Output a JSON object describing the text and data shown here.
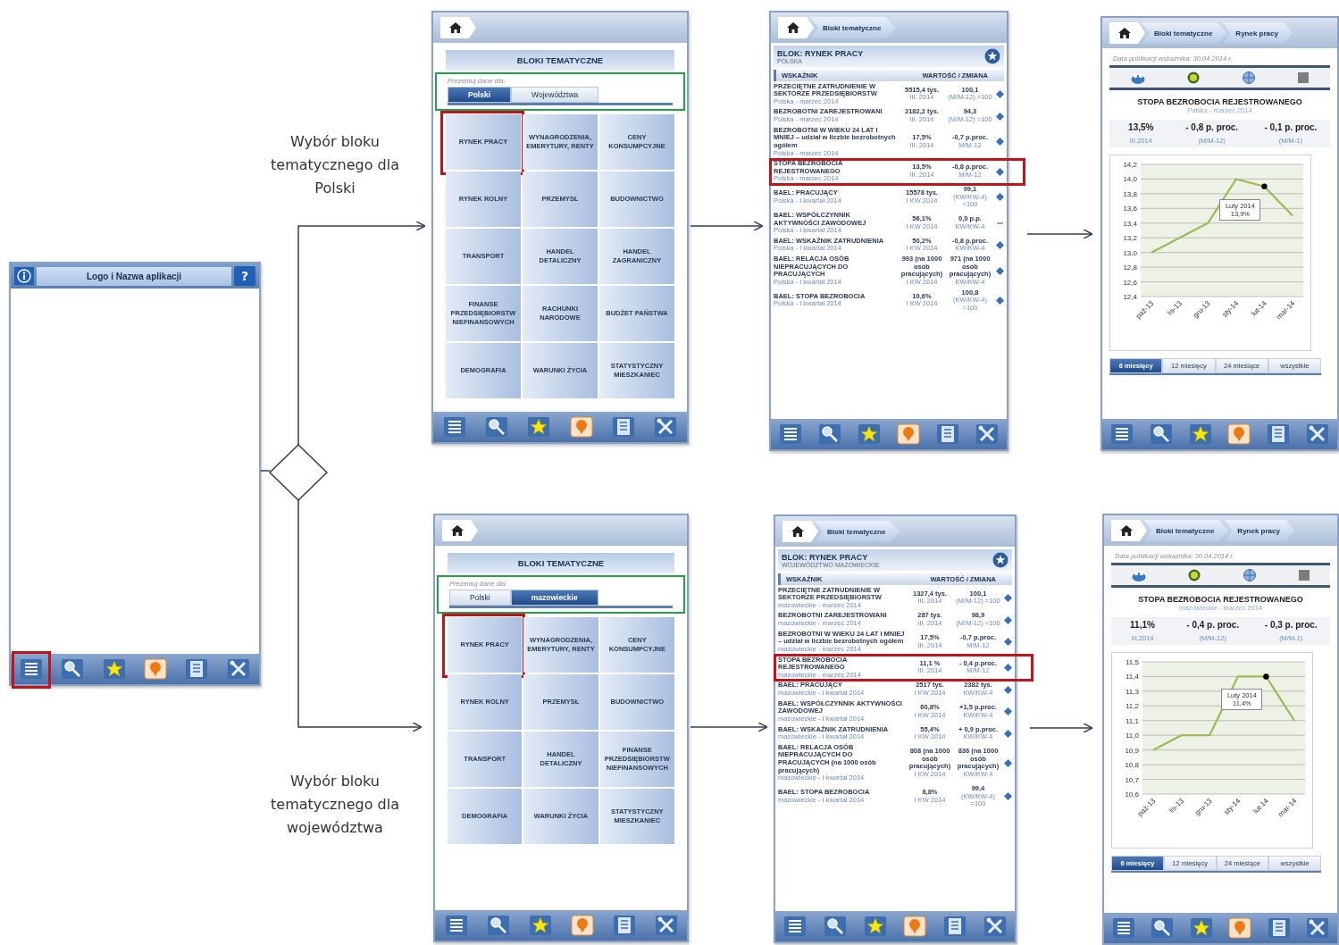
{
  "start_screen": {
    "title": "Logo i Nazwa aplikacji",
    "help_glyph": "?",
    "toolbar": [
      {
        "kind": "list",
        "highlighted": true
      },
      {
        "kind": "search",
        "highlighted": false
      },
      {
        "kind": "star",
        "highlighted": false
      },
      {
        "kind": "pin",
        "highlighted": false
      },
      {
        "kind": "notes",
        "highlighted": false
      },
      {
        "kind": "tools",
        "highlighted": false
      }
    ]
  },
  "branches": [
    {
      "label": "Wybór bloku tematycznego dla Polski",
      "menu_screen": {
        "title": "BLOKI TEMATYCZNE",
        "prompt": "Prezentuj dane dla:",
        "tabs_highlighted": true,
        "tabs": [
          {
            "label": "Polski",
            "selected": true
          },
          {
            "label": "Województwa",
            "selected": false
          }
        ],
        "tiles": [
          {
            "label": "RYNEK PRACY",
            "highlighted": true
          },
          {
            "label": "WYNAGRODZENIA, EMERYTURY, RENTY",
            "highlighted": false
          },
          {
            "label": "CENY KONSUMPCYJNE",
            "highlighted": false
          },
          {
            "label": "RYNEK ROLNY",
            "highlighted": false
          },
          {
            "label": "PRZEMYSŁ",
            "highlighted": false
          },
          {
            "label": "BUDOWNICTWO",
            "highlighted": false
          },
          {
            "label": "TRANSPORT",
            "highlighted": false
          },
          {
            "label": "HANDEL DETALICZNY",
            "highlighted": false
          },
          {
            "label": "HANDEL ZAGRANICZNY",
            "highlighted": false
          },
          {
            "label": "FINANSE PRZEDSIĘBIORSTW NIEFINANSOWYCH",
            "highlighted": false
          },
          {
            "label": "RACHUNKI NARODOWE",
            "highlighted": false
          },
          {
            "label": "BUDŻET PAŃSTWA",
            "highlighted": false
          },
          {
            "label": "DEMOGRAFIA",
            "highlighted": false
          },
          {
            "label": "WARUNKI ŻYCIA",
            "highlighted": false
          },
          {
            "label": "STATYSTYCZNY MIESZKANIEC",
            "highlighted": false
          }
        ],
        "toolbar": [
          {
            "kind": "list",
            "highlighted": false
          },
          {
            "kind": "search",
            "highlighted": false
          },
          {
            "kind": "star",
            "highlighted": false
          },
          {
            "kind": "pin",
            "highlighted": false
          },
          {
            "kind": "notes",
            "highlighted": false
          },
          {
            "kind": "tools",
            "highlighted": false
          }
        ]
      },
      "table_screen": {
        "breadcrumbs": [
          "Bloki tematyczne"
        ],
        "block_title": "BLOK: RYNEK PRACY",
        "region": "POLSKA",
        "columns": [
          "WSKAŹNIK",
          "WARTOŚĆ / ZMIANA"
        ],
        "rows": [
          {
            "name": "PRZECIĘTNE ZATRUDNIENIE W SEKTORZE PRZEDSIĘBIORSTW",
            "region_date": "Polska - marzec 2014",
            "value": "5515,4 tys.",
            "value_period": "III. 2014",
            "change": "100,1",
            "change_period": "(M/M-12) =100",
            "kind": "diamond",
            "highlighted": false
          },
          {
            "name": "BEZROBOTNI ZAREJESTROWANI",
            "region_date": "Polska - marzec 2014",
            "value": "2182,2 tys.",
            "value_period": "III. 2014",
            "change": "94,3",
            "change_period": "(M/M-12) =100",
            "kind": "diamond",
            "highlighted": false
          },
          {
            "name": "BEZROBOTNI W WIEKU 24 LAT I MNIEJ – udział w liczbie bezrobotnych ogółem",
            "region_date": "Polska - marzec 2014",
            "value": "17,5%",
            "value_period": "III. 2014",
            "change": "-0,7 p.proc.",
            "change_period": "M/M-12",
            "kind": "diamond",
            "highlighted": false
          },
          {
            "name": "STOPA BEZROBOCIA REJESTROWANEGO",
            "region_date": "Polska - marzec 2014",
            "value": "13,5%",
            "value_period": "III. 2014",
            "change": "-0,8 p.proc.",
            "change_period": "M/M-12",
            "kind": "diamond",
            "highlighted": true
          },
          {
            "name": "BAEL: PRACUJĄCY",
            "region_date": "Polska - I kwartał 2014",
            "value": "15578 tys.",
            "value_period": "I KW 2014",
            "change": "99,1",
            "change_period": "(KW/KW-4) =100",
            "kind": "diamond",
            "highlighted": false
          },
          {
            "name": "BAEL: WSPÓŁCZYNNIK AKTYWNOŚCI ZAWODOWEJ",
            "region_date": "Polska - I kwartał 2014",
            "value": "56,1%",
            "value_period": "I KW 2014",
            "change": "0,0 p.p.",
            "change_period": "KW/KW-4",
            "kind": "dash",
            "highlighted": false
          },
          {
            "name": "BAEL: WSKAŹNIK ZATRUDNIENIA",
            "region_date": "Polska - I kwartał 2014",
            "value": "50,2%",
            "value_period": "I KW 2014",
            "change": "-0,8 p.proc.",
            "change_period": "KW/KW-4",
            "kind": "diamond",
            "highlighted": false
          },
          {
            "name": "BAEL: RELACJA OSÓB NIEPRACUJĄCYCH DO PRACUJĄCYCH",
            "region_date": "Polska - I kwartał 2014",
            "value": "993 (na 1000 osób pracujących)",
            "value_period": "I KW 2014",
            "change": "971 (na 1000 osób pracujących)",
            "change_period": "KW/KW-4",
            "kind": "diamond",
            "highlighted": false
          },
          {
            "name": "BAEL: STOPA BEZROBOCIA",
            "region_date": "Polska - I kwartał 2014",
            "value": "10,6%",
            "value_period": "I KW 2014",
            "change": "100,8",
            "change_period": "(KW/KW-4) =100",
            "kind": "diamond",
            "highlighted": false
          }
        ],
        "toolbar": [
          {
            "kind": "list",
            "highlighted": false
          },
          {
            "kind": "search",
            "highlighted": false
          },
          {
            "kind": "star",
            "highlighted": false
          },
          {
            "kind": "pin",
            "highlighted": false
          },
          {
            "kind": "notes",
            "highlighted": false
          },
          {
            "kind": "tools",
            "highlighted": false
          }
        ]
      },
      "chart_screen": {
        "breadcrumbs": [
          "Bloki tematyczne",
          "Rynek pracy"
        ],
        "publication_date": "Data publikacji wskaźnika: 30.04.2014 r.",
        "title": "STOPA BEZROBOCIA REJESTROWANEGO",
        "subtitle": "Polska - marzec 2014",
        "stats": [
          {
            "value": "13,5%",
            "period": "III.2014"
          },
          {
            "value": "- 0,8 p. proc.",
            "period": "(M/M-12)"
          },
          {
            "value": "- 0,1 p. proc.",
            "period": "(M/M-1)"
          }
        ],
        "chart_data": {
          "type": "line",
          "categories": [
            "paź-13",
            "lis-13",
            "gru-13",
            "sty-14",
            "lut-14",
            "mar-14"
          ],
          "values": [
            13.0,
            13.2,
            13.4,
            14.0,
            13.9,
            13.5
          ],
          "ylim": [
            12.4,
            14.2
          ],
          "yticks": [
            {
              "value": 12.4,
              "label": "12,4"
            },
            {
              "value": 12.6,
              "label": "12,6"
            },
            {
              "value": 12.8,
              "label": "12,8"
            },
            {
              "value": 13.0,
              "label": "13,0"
            },
            {
              "value": 13.2,
              "label": "13,2"
            },
            {
              "value": 13.4,
              "label": "13,4"
            },
            {
              "value": 13.6,
              "label": "13,6"
            },
            {
              "value": 13.8,
              "label": "13,8"
            },
            {
              "value": 14.0,
              "label": "14,0"
            },
            {
              "value": 14.2,
              "label": "14,2"
            }
          ],
          "grid": true,
          "annotations": [
            {
              "x": "lut-14",
              "y": 13.9,
              "text": "Luty 2014 13,9%"
            }
          ]
        },
        "periods": [
          {
            "label": "6 miesięcy",
            "selected": true
          },
          {
            "label": "12 miesięcy",
            "selected": false
          },
          {
            "label": "24 miesiące",
            "selected": false
          },
          {
            "label": "wszystkie",
            "selected": false
          }
        ],
        "toolbar": [
          {
            "kind": "list",
            "highlighted": false
          },
          {
            "kind": "search",
            "highlighted": false
          },
          {
            "kind": "star",
            "highlighted": false
          },
          {
            "kind": "pin",
            "highlighted": false
          },
          {
            "kind": "notes",
            "highlighted": false
          },
          {
            "kind": "tools",
            "highlighted": false
          }
        ]
      }
    },
    {
      "label": "Wybór bloku tematycznego dla województwa",
      "menu_screen": {
        "title": "BLOKI TEMATYCZNE",
        "prompt": "Prezentuj dane dla:",
        "tabs_highlighted": true,
        "tabs": [
          {
            "label": "Polski",
            "selected": false
          },
          {
            "label": "mazowieckie",
            "selected": true
          }
        ],
        "tiles": [
          {
            "label": "RYNEK PRACY",
            "highlighted": true
          },
          {
            "label": "WYNAGRODZENIA, EMERYTURY, RENTY",
            "highlighted": false
          },
          {
            "label": "CENY KONSUMPCYJNE",
            "highlighted": false
          },
          {
            "label": "RYNEK ROLNY",
            "highlighted": false
          },
          {
            "label": "PRZEMYSŁ",
            "highlighted": false
          },
          {
            "label": "BUDOWNICTWO",
            "highlighted": false
          },
          {
            "label": "TRANSPORT",
            "highlighted": false
          },
          {
            "label": "HANDEL DETALICZNY",
            "highlighted": false
          },
          {
            "label": "FINANSE PRZEDSIĘBIORSTW NIEFINANSOWYCH",
            "highlighted": false
          },
          {
            "label": "DEMOGRAFIA",
            "highlighted": false
          },
          {
            "label": "WARUNKI ŻYCIA",
            "highlighted": false
          },
          {
            "label": "STATYSTYCZNY MIESZKANIEC",
            "highlighted": false
          }
        ],
        "toolbar": [
          {
            "kind": "list",
            "highlighted": false
          },
          {
            "kind": "search",
            "highlighted": false
          },
          {
            "kind": "star",
            "highlighted": false
          },
          {
            "kind": "pin",
            "highlighted": false
          },
          {
            "kind": "notes",
            "highlighted": false
          },
          {
            "kind": "tools",
            "highlighted": false
          }
        ]
      },
      "table_screen": {
        "breadcrumbs": [
          "Bloki tematyczne"
        ],
        "block_title": "BLOK: RYNEK PRACY",
        "region": "WOJEWÓDZTWO MAZOWIECKIE",
        "columns": [
          "WSKAŹNIK",
          "WARTOŚĆ / ZMIANA"
        ],
        "rows": [
          {
            "name": "PRZECIĘTNE ZATRUDNIENIE W SEKTORZE PRZEDSIĘBIORSTW",
            "region_date": "mazowieckie - marzec 2014",
            "value": "1327,4 tys.",
            "value_period": "III. 2014",
            "change": "100,1",
            "change_period": "(M/M-12) =100",
            "kind": "diamond",
            "highlighted": false
          },
          {
            "name": "BEZROBOTNI ZAREJESTROWANI",
            "region_date": "mazowieckie - marzec 2014",
            "value": "287 tys.",
            "value_period": "III. 2014",
            "change": "98,9",
            "change_period": "(M/M-12) =100",
            "kind": "diamond",
            "highlighted": false
          },
          {
            "name": "BEZROBOTNI W WIEKU 24 LAT I MNIEJ – udział w liczbie bezrobotnych ogółem",
            "region_date": "mazowieckie - marzec 2014",
            "value": "17,5%",
            "value_period": "III. 2014",
            "change": "-0,7 p.proc.",
            "change_period": "M/M-12",
            "kind": "diamond",
            "highlighted": false
          },
          {
            "name": "STOPA BEZROBOCIA REJESTROWANEGO",
            "region_date": "mazowieckie - marzec 2014",
            "value": "11,1 %",
            "value_period": "III. 2014",
            "change": "- 0,4 p.proc.",
            "change_period": "M/M-12",
            "kind": "diamond",
            "highlighted": true
          },
          {
            "name": "BAEL: PRACUJĄCY",
            "region_date": "mazowieckie - I kwartał 2014",
            "value": "2517 tys.",
            "value_period": "I KW 2014",
            "change": "2382 tys.",
            "change_period": "KW/KW-4",
            "kind": "diamond",
            "highlighted": false
          },
          {
            "name": "BAEL: WSPÓŁCZYNNIK AKTYWNOŚCI ZAWODOWEJ",
            "region_date": "mazowieckie - I kwartał 2014",
            "value": "60,8%",
            "value_period": "I KW 2014",
            "change": "+1,5 p.proc.",
            "change_period": "KW/KW-4",
            "kind": "diamond",
            "highlighted": false
          },
          {
            "name": "BAEL: WSKAŹNIK ZATRUDNIENIA",
            "region_date": "mazowieckie - I kwartał 2014",
            "value": "55,4%",
            "value_period": "I KW 2014",
            "change": "+ 0,9 p.proc.",
            "change_period": "KW/KW-4",
            "kind": "diamond",
            "highlighted": false
          },
          {
            "name": "BAEL: RELACJA OSÓB NIEPRACUJĄCYCH DO PRACUJĄCYCH (na 1000 osób pracujących)",
            "region_date": "mazowieckie - I kwartał 2014",
            "value": "808 (na 1000 osób pracujących)",
            "value_period": "I KW 2014",
            "change": "836 (na 1000 osób pracujących)",
            "change_period": "KW/KW-4",
            "kind": "diamond",
            "highlighted": false
          },
          {
            "name": "BAEL: STOPA BEZROBOCIA",
            "region_date": "mazowieckie - I kwartał 2014",
            "value": "8,8%",
            "value_period": "I KW 2014",
            "change": "99,4",
            "change_period": "(KW/KW-4) =100",
            "kind": "diamond",
            "highlighted": false
          }
        ],
        "toolbar": [
          {
            "kind": "list",
            "highlighted": false
          },
          {
            "kind": "search",
            "highlighted": false
          },
          {
            "kind": "star",
            "highlighted": false
          },
          {
            "kind": "pin",
            "highlighted": false
          },
          {
            "kind": "notes",
            "highlighted": false
          },
          {
            "kind": "tools",
            "highlighted": false
          }
        ]
      },
      "chart_screen": {
        "breadcrumbs": [
          "Bloki tematyczne",
          "Rynek pracy"
        ],
        "publication_date": "Data publikacji wskaźnika: 30.04.2014 r.",
        "title": "STOPA BEZROBOCIA REJESTROWANEGO",
        "subtitle": "mazowieckie - marzec 2014",
        "stats": [
          {
            "value": "11,1%",
            "period": "III.2014"
          },
          {
            "value": "- 0,4 p. proc.",
            "period": "(M/M-12)"
          },
          {
            "value": "- 0,3 p. proc.",
            "period": "(M/M-1)"
          }
        ],
        "chart_data": {
          "type": "line",
          "categories": [
            "paź-13",
            "lis-13",
            "gru-13",
            "sty-14",
            "lut-14",
            "mar-14"
          ],
          "values": [
            10.9,
            11.0,
            11.0,
            11.4,
            11.4,
            11.1
          ],
          "ylim": [
            10.6,
            11.5
          ],
          "yticks": [
            {
              "value": 10.6,
              "label": "10,6"
            },
            {
              "value": 10.7,
              "label": "10,7"
            },
            {
              "value": 10.8,
              "label": "10,8"
            },
            {
              "value": 10.9,
              "label": "10,9"
            },
            {
              "value": 11.0,
              "label": "11,0"
            },
            {
              "value": 11.1,
              "label": "11,1"
            },
            {
              "value": 11.2,
              "label": "11,2"
            },
            {
              "value": 11.3,
              "label": "11,3"
            },
            {
              "value": 11.4,
              "label": "11,4"
            },
            {
              "value": 11.5,
              "label": "11,5"
            }
          ],
          "grid": true,
          "annotations": [
            {
              "x": "lut-14",
              "y": 11.4,
              "text": "Luty 2014 11,4%"
            }
          ]
        },
        "periods": [
          {
            "label": "6 miesięcy",
            "selected": true
          },
          {
            "label": "12 miesięcy",
            "selected": false
          },
          {
            "label": "24 miesiące",
            "selected": false
          },
          {
            "label": "wszystkie",
            "selected": false
          }
        ],
        "toolbar": [
          {
            "kind": "list",
            "highlighted": false
          },
          {
            "kind": "search",
            "highlighted": false
          },
          {
            "kind": "star",
            "highlighted": false
          },
          {
            "kind": "pin",
            "highlighted": false
          },
          {
            "kind": "notes",
            "highlighted": false
          },
          {
            "kind": "tools",
            "highlighted": false
          }
        ]
      }
    }
  ]
}
